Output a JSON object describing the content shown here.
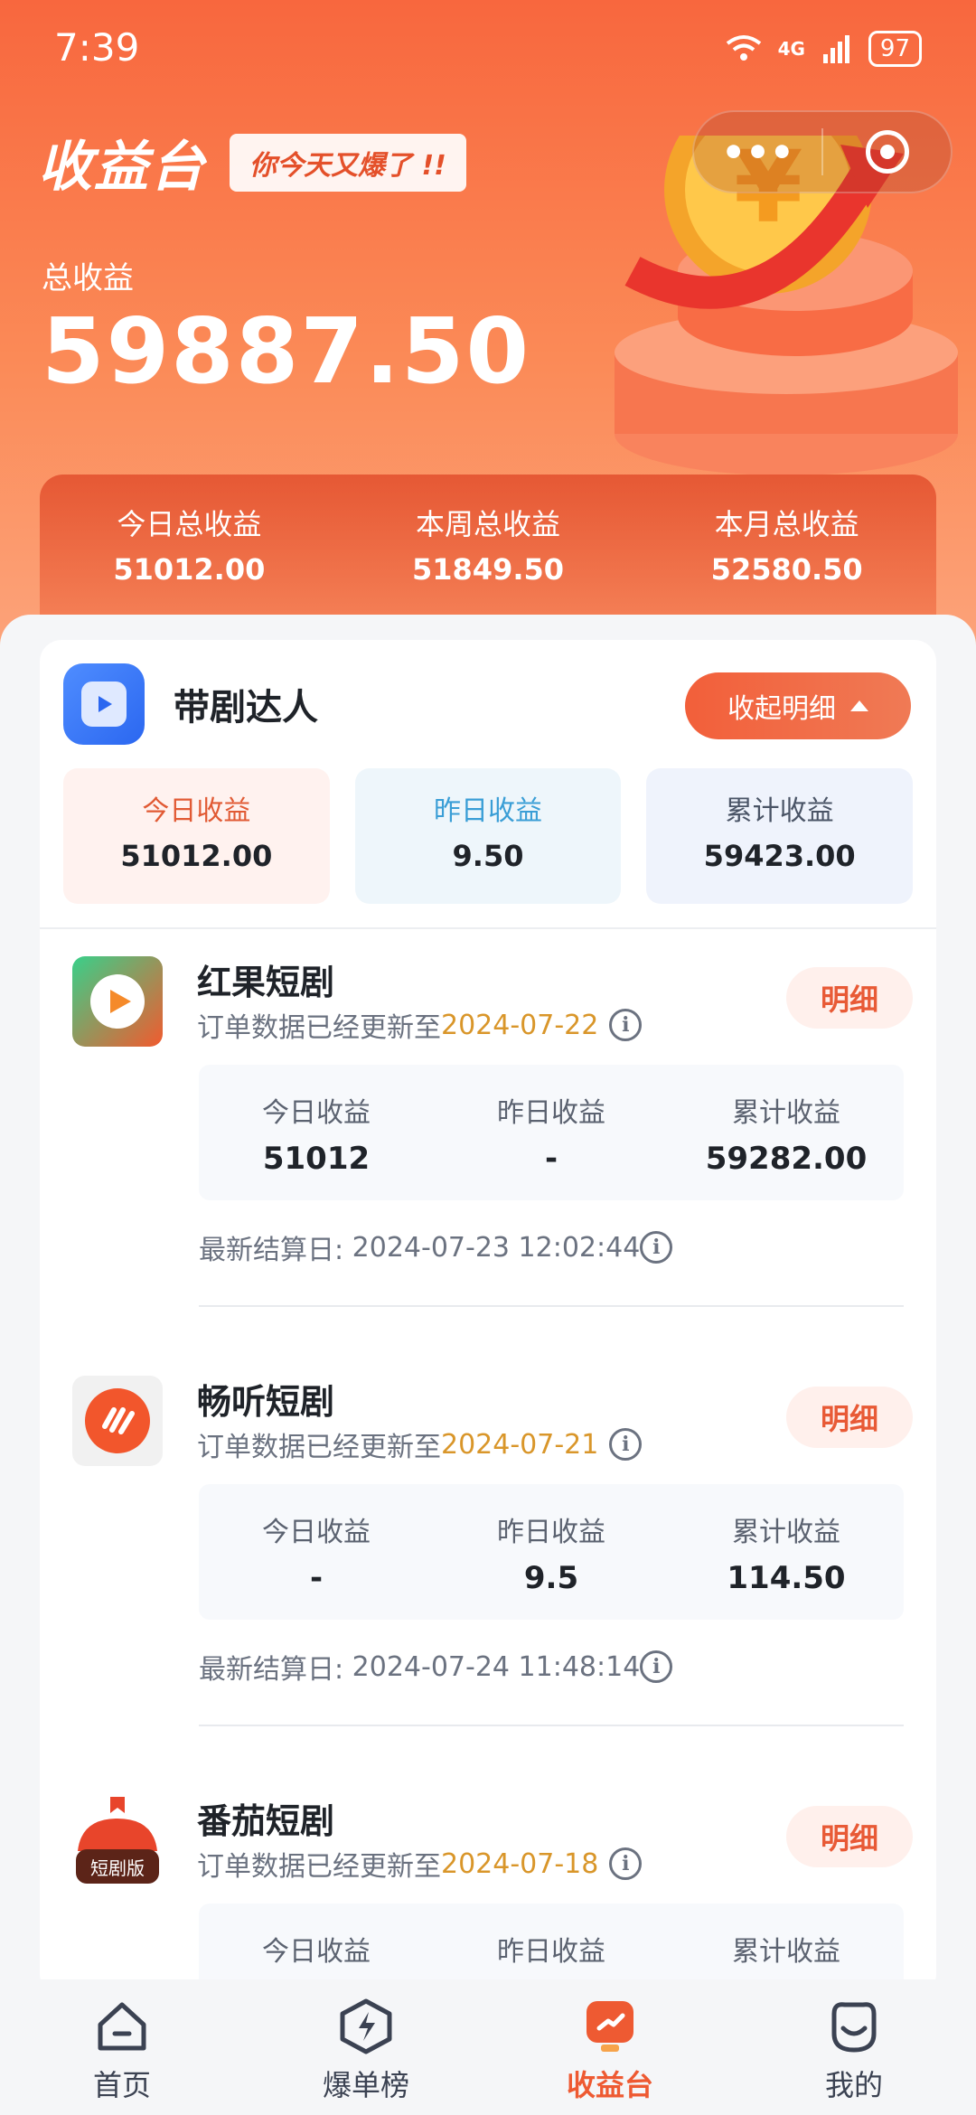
{
  "status": {
    "time": "7:39",
    "signal": "4G",
    "battery": "97"
  },
  "header": {
    "title": "收益台",
    "tag": "你今天又爆了 !!"
  },
  "total": {
    "label": "总收益",
    "value": "59887.50"
  },
  "periods": [
    {
      "label": "今日总收益",
      "value": "51012.00"
    },
    {
      "label": "本周总收益",
      "value": "51849.50"
    },
    {
      "label": "本月总收益",
      "value": "52580.50"
    }
  ],
  "account": {
    "name": "带剧达人",
    "collapse_label": "收起明细",
    "summary": [
      {
        "label": "今日收益",
        "value": "51012.00"
      },
      {
        "label": "昨日收益",
        "value": "9.50"
      },
      {
        "label": "累计收益",
        "value": "59423.00"
      }
    ]
  },
  "dramas": [
    {
      "name": "红果短剧",
      "update_prefix": "订单数据已经更新至",
      "update_date": "2024-07-22",
      "detail_label": "明细",
      "stats": [
        {
          "label": "今日收益",
          "value": "51012"
        },
        {
          "label": "昨日收益",
          "value": "-"
        },
        {
          "label": "累计收益",
          "value": "59282.00"
        }
      ],
      "settle_label": "最新结算日:",
      "settle_time": "2024-07-23 12:02:44"
    },
    {
      "name": "畅听短剧",
      "update_prefix": "订单数据已经更新至",
      "update_date": "2024-07-21",
      "detail_label": "明细",
      "stats": [
        {
          "label": "今日收益",
          "value": "-"
        },
        {
          "label": "昨日收益",
          "value": "9.5"
        },
        {
          "label": "累计收益",
          "value": "114.50"
        }
      ],
      "settle_label": "最新结算日:",
      "settle_time": "2024-07-24 11:48:14"
    },
    {
      "name": "番茄短剧",
      "update_prefix": "订单数据已经更新至",
      "update_date": "2024-07-18",
      "detail_label": "明细",
      "logo_text": "短剧版",
      "stats": [
        {
          "label": "今日收益",
          "value": ""
        },
        {
          "label": "昨日收益",
          "value": ""
        },
        {
          "label": "累计收益",
          "value": ""
        }
      ]
    }
  ],
  "tabbar": [
    {
      "label": "首页",
      "icon": "home-icon"
    },
    {
      "label": "爆单榜",
      "icon": "lightning-icon"
    },
    {
      "label": "收益台",
      "icon": "revenue-icon",
      "active": true
    },
    {
      "label": "我的",
      "icon": "profile-icon"
    }
  ],
  "colors": {
    "accent": "#f25f3a",
    "date": "#d9962a"
  }
}
